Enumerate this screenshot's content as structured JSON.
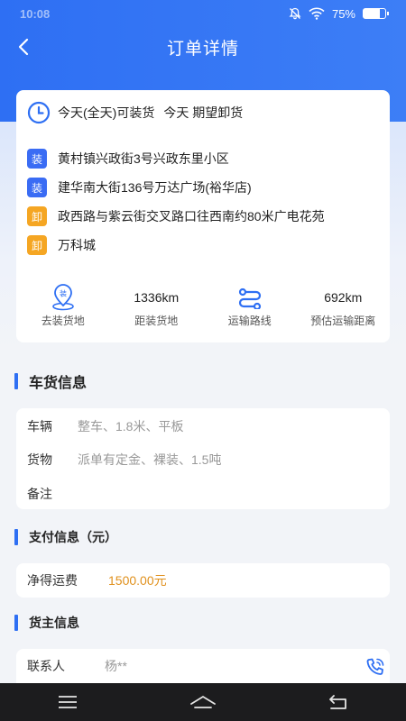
{
  "status_bar": {
    "time": "10:08",
    "battery": "75%",
    "battery_level": 0.75
  },
  "nav": {
    "title": "订单详情"
  },
  "route": {
    "load_time": "今天(全天)可装货",
    "unload_time": "今天 期望卸货",
    "addresses": [
      {
        "tag": "装",
        "kind": "load",
        "text": "黄村镇兴政街3号兴政东里小区"
      },
      {
        "tag": "装",
        "kind": "load",
        "text": "建华南大街136号万达广场(裕华店)"
      },
      {
        "tag": "卸",
        "kind": "unload",
        "text": "政西路与紫云街交叉路口往西南约80米广电花苑"
      },
      {
        "tag": "卸",
        "kind": "unload",
        "text": "万科城"
      }
    ],
    "stats": {
      "goto_label": "去装货地",
      "distance_value": "1336km",
      "distance_label": "距装货地",
      "route_label": "运输路线",
      "transport_value": "692km",
      "transport_label": "预估运输距离",
      "pin_tag": "装"
    }
  },
  "vehicle_section": {
    "title": "车货信息",
    "vehicle_key": "车辆",
    "vehicle_val": "整车、1.8米、平板",
    "cargo_key": "货物",
    "cargo_val": "派单有定金、裸装、1.5吨",
    "note_key": "备注",
    "note_val": ""
  },
  "payment_section": {
    "title": "支付信息（元）",
    "fee_key": "净得运费",
    "fee_val": "1500.00元"
  },
  "owner_section": {
    "title": "货主信息",
    "contact_key": "联系人",
    "contact_val": "杨**"
  },
  "colors": {
    "primary": "#2e6ff3",
    "load_tag": "#3a6cf4",
    "unload_tag": "#f5a623",
    "price": "#e0901c"
  }
}
